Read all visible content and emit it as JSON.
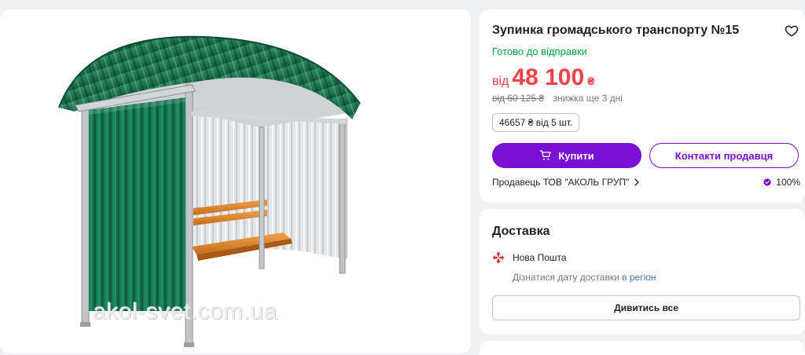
{
  "product": {
    "image_watermark": "akol-svet.com.ua"
  },
  "info": {
    "title": "Зупинка громадського транспорту №15",
    "status": "Готово до відправки",
    "price_prefix": "від",
    "price_value": "48 100",
    "price_currency": "₴",
    "old_price": "від 60 125 ₴",
    "discount_note": "знижка ще 3 дні",
    "wholesale": "46657 ₴ від 5 шт.",
    "buy_label": "Купити",
    "contact_label": "Контакти продавця",
    "seller_text": "Продавець ТОВ \"АКОЛЬ ГРУП\"",
    "rating": "100%"
  },
  "delivery": {
    "title": "Доставка",
    "carrier": "Нова Пошта",
    "hint_text": "Дізнатися дату доставки в",
    "hint_link": "регіон",
    "see_all_label": "Дивитись все"
  },
  "colors": {
    "accent": "#7a10d3",
    "price": "#f84147",
    "status": "#00a046",
    "np_red": "#ed1c24"
  },
  "icons": [
    "heart-icon",
    "cart-icon",
    "chevron-right-icon",
    "rating-badge-icon",
    "nova-poshta-logo"
  ]
}
